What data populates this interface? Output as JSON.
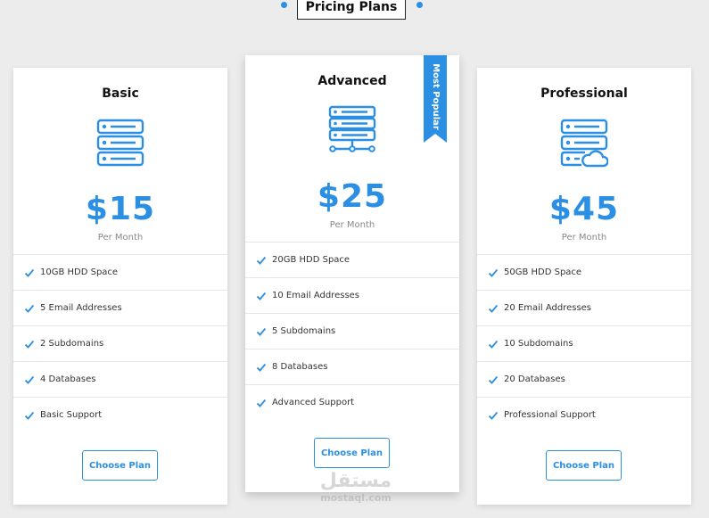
{
  "section": {
    "title": "Pricing Plans"
  },
  "colors": {
    "accent": "#2b8fe3",
    "background": "#ececec",
    "card": "#ffffff"
  },
  "plans": [
    {
      "name": "Basic",
      "icon": "server-stack-icon",
      "price": "$15",
      "period": "Per Month",
      "features": [
        "10GB HDD Space",
        "5 Email Addresses",
        "2 Subdomains",
        "4 Databases",
        "Basic Support"
      ],
      "button_label": "Choose Plan"
    },
    {
      "name": "Advanced",
      "icon": "server-network-icon",
      "price": "$25",
      "period": "Per Month",
      "badge": "Most Popular",
      "features": [
        "20GB HDD Space",
        "10 Email Addresses",
        "5 Subdomains",
        "8 Databases",
        "Advanced Support"
      ],
      "button_label": "Choose Plan"
    },
    {
      "name": "Professional",
      "icon": "server-cloud-icon",
      "price": "$45",
      "period": "Per Month",
      "features": [
        "50GB HDD Space",
        "20 Email Addresses",
        "10 Subdomains",
        "20 Databases",
        "Professional Support"
      ],
      "button_label": "Choose Plan"
    }
  ],
  "watermark": {
    "arabic": "مستقل",
    "latin": "mostaql.com"
  }
}
